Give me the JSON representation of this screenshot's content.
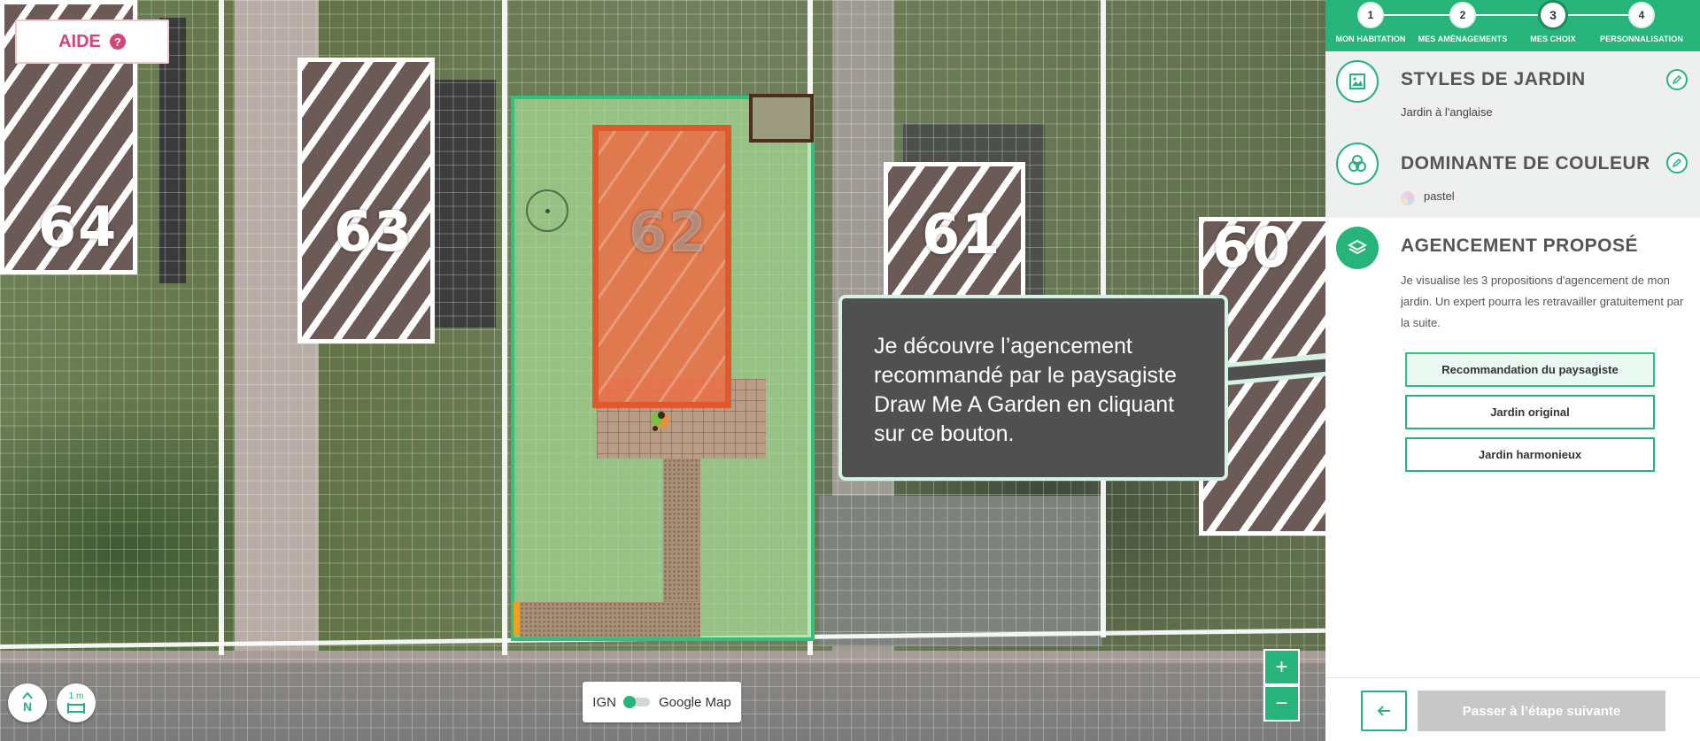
{
  "help": {
    "label": "AIDE",
    "icon": "question-icon"
  },
  "map": {
    "plot_numbers": [
      "64",
      "63",
      "62",
      "61",
      "60"
    ],
    "scale_label": "1 m",
    "north_label": "N",
    "layer_toggle": {
      "left_label": "IGN",
      "right_label": "Google Map"
    },
    "zoom_in": "+",
    "zoom_out": "−"
  },
  "tooltip": {
    "text": "Je découvre l’agencement recommandé par le paysagiste Draw Me A Garden en cliquant sur ce bouton."
  },
  "stepper": {
    "steps": [
      {
        "number": "1",
        "label": "MON HABITATION"
      },
      {
        "number": "2",
        "label": "MES AMÉNAGEMENTS"
      },
      {
        "number": "3",
        "label": "MES CHOIX"
      },
      {
        "number": "4",
        "label": "PERSONNALISATION"
      }
    ],
    "active_step": 3
  },
  "sections": {
    "style": {
      "title": "STYLES DE JARDIN",
      "value": "Jardin à l'anglaise"
    },
    "color": {
      "title": "DOMINANTE DE COULEUR",
      "value": "pastel"
    },
    "layout": {
      "title": "AGENCEMENT PROPOSÉ",
      "description": "Je visualise les 3 propositions d'agencement de mon jardin. Un expert pourra les retravailler gratuitement par la suite.",
      "options": [
        "Recommandation du paysagiste",
        "Jardin original",
        "Jardin harmonieux"
      ]
    }
  },
  "footer": {
    "back_icon": "arrow-left-icon",
    "next_label": "Passer à l’étape suivante"
  },
  "colors": {
    "accent": "#27b47a",
    "help": "#d5447a",
    "house_highlight": "#e0582c"
  }
}
